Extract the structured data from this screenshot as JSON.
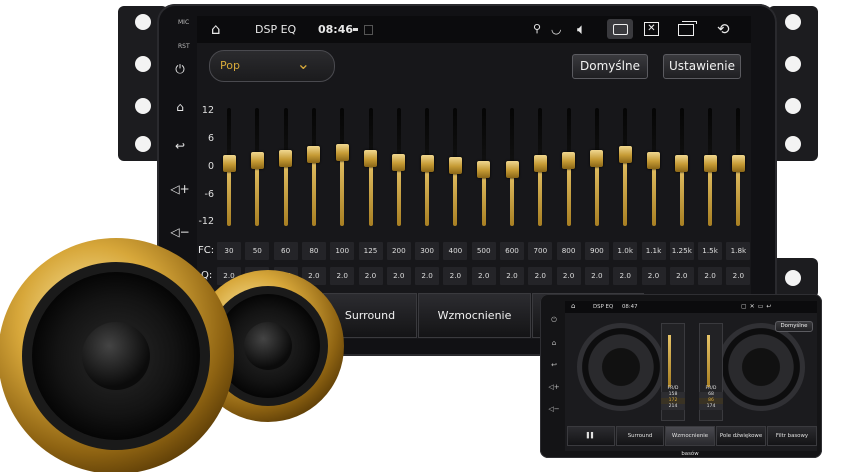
{
  "statusbar": {
    "title": "DSP EQ",
    "time": "08:46",
    "icons": [
      "home-icon",
      "location-icon",
      "wifi-icon",
      "volume-icon",
      "screenshot-icon",
      "close-window-icon",
      "recent-apps-icon",
      "back-icon"
    ]
  },
  "side_panel": {
    "mic_label": "MIC",
    "rst_label": "RST",
    "icons": [
      "power-icon",
      "home-icon",
      "back-icon",
      "volume-up-icon",
      "volume-down-icon"
    ]
  },
  "eq": {
    "preset": "Pop",
    "default_button": "Domyślne",
    "settings_button": "Ustawienie",
    "y_ticks": [
      "12",
      "6",
      "0",
      "-6",
      "-12"
    ],
    "fc_label": "FC:",
    "q_label": "Q:",
    "bands": [
      {
        "fc": "30",
        "q": "2.0",
        "gain": 1.2
      },
      {
        "fc": "50",
        "q": "2.0",
        "gain": 2.0
      },
      {
        "fc": "60",
        "q": "2.0",
        "gain": 2.5
      },
      {
        "fc": "80",
        "q": "2.0",
        "gain": 3.5
      },
      {
        "fc": "100",
        "q": "2.0",
        "gain": 4.0
      },
      {
        "fc": "125",
        "q": "2.0",
        "gain": 2.5
      },
      {
        "fc": "200",
        "q": "2.0",
        "gain": 1.5
      },
      {
        "fc": "300",
        "q": "2.0",
        "gain": 1.0
      },
      {
        "fc": "400",
        "q": "2.0",
        "gain": 0.5
      },
      {
        "fc": "500",
        "q": "2.0",
        "gain": -0.5
      },
      {
        "fc": "600",
        "q": "2.0",
        "gain": -0.5
      },
      {
        "fc": "700",
        "q": "2.0",
        "gain": 1.0
      },
      {
        "fc": "800",
        "q": "2.0",
        "gain": 2.0
      },
      {
        "fc": "900",
        "q": "2.0",
        "gain": 2.5
      },
      {
        "fc": "1.0k",
        "q": "2.0",
        "gain": 3.5
      },
      {
        "fc": "1.1k",
        "q": "2.0",
        "gain": 2.0
      },
      {
        "fc": "1.25k",
        "q": "2.0",
        "gain": 1.0
      },
      {
        "fc": "1.5k",
        "q": "2.0",
        "gain": 1.0
      },
      {
        "fc": "1.8k",
        "q": "2.0",
        "gain": 1.0
      }
    ]
  },
  "bottom_tabs": [
    "Surround",
    "Wzmocnienie basów"
  ],
  "mini_preview": {
    "title": "DSP EQ",
    "time": "08:47",
    "default_button": "Domyślne",
    "left_readouts": [
      "FR/D",
      "158",
      "172",
      "214"
    ],
    "right_readouts": [
      "FR/D",
      "68",
      "86",
      "174"
    ],
    "tabs": [
      "Surround",
      "Wzmocnienie basów",
      "Pole dźwiękowe",
      "Filtr basowy"
    ]
  },
  "colors": {
    "accent_gold": "#d7a93a",
    "screen_bg": "#17171a",
    "frame": "#111114"
  }
}
